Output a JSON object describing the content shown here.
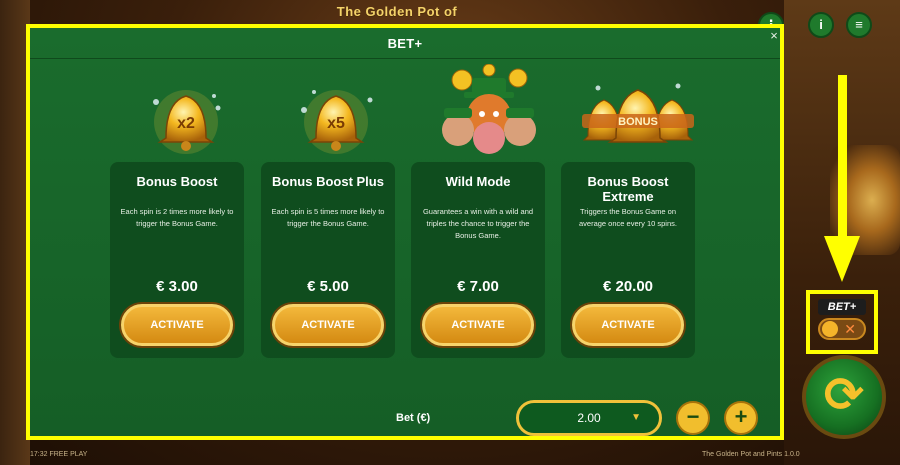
{
  "game": {
    "title": "The Golden Pot of Pints",
    "footer_left": "17:32 FREE PLAY",
    "footer_right": "The Golden Pot and Pints 1.0.0",
    "top_icons": [
      "grid-icon",
      "info-icon",
      "menu-icon"
    ]
  },
  "modal": {
    "title": "BET+",
    "close_label": "×"
  },
  "options": [
    {
      "title": "Bonus Boost",
      "description": "Each spin is 2 times more likely to trigger the Bonus Game.",
      "price": "€ 3.00",
      "button": "ACTIVATE",
      "badge": "x2"
    },
    {
      "title": "Bonus Boost Plus",
      "description": "Each spin is 5 times more likely to trigger the Bonus Game.",
      "price": "€ 5.00",
      "button": "ACTIVATE",
      "badge": "x5"
    },
    {
      "title": "Wild Mode",
      "description": "Guarantees a win with a wild and triples the chance to trigger the Bonus Game.",
      "price": "€ 7.00",
      "button": "ACTIVATE",
      "badge": ""
    },
    {
      "title": "Bonus Boost Extreme",
      "description": "Triggers the Bonus Game on average once every 10 spins.",
      "price": "€ 20.00",
      "button": "ACTIVATE",
      "badge": "BONUS"
    }
  ],
  "bet": {
    "label": "Bet (€)",
    "value": "2.00",
    "minus": "−",
    "plus": "+"
  },
  "betplus_toggle": {
    "label": "BET+",
    "state": "off",
    "off_symbol": "✕"
  },
  "colors": {
    "highlight": "#ffff00",
    "modal_bg": "#17652a",
    "card_bg": "#0f4d1e",
    "button_gold": "#f3b83b"
  }
}
